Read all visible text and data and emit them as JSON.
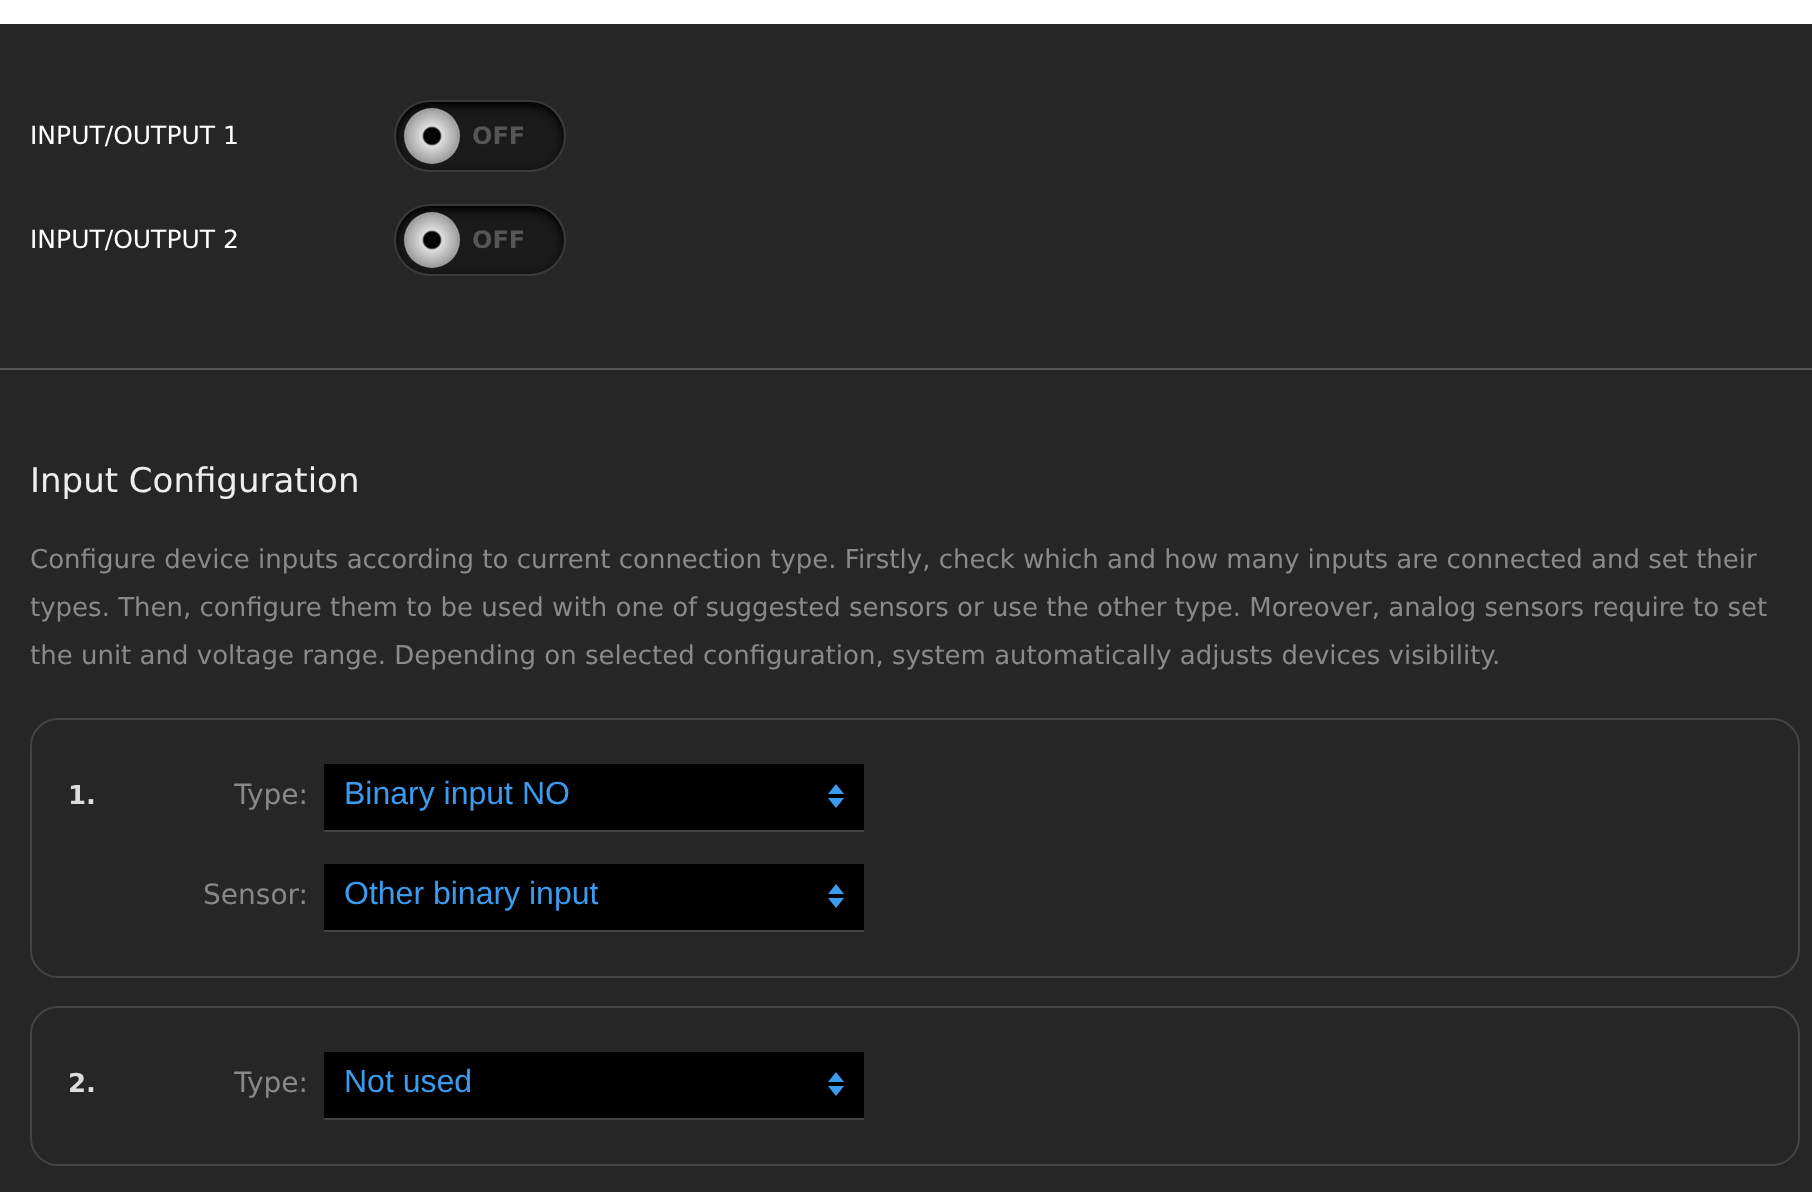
{
  "switches": [
    {
      "label": "INPUT/OUTPUT 1",
      "on": false,
      "state_text": "OFF"
    },
    {
      "label": "INPUT/OUTPUT 2",
      "on": false,
      "state_text": "OFF"
    }
  ],
  "section": {
    "title": "Input Configuration",
    "description": "Configure device inputs according to current connection type. Firstly, check which and how many inputs are connected and set their types. Then, configure them to be used with one of suggested sensors or use the other type. Moreover, analog sensors require to set the unit and voltage range. Depending on selected configuration, system automatically adjusts devices visibility."
  },
  "inputs": [
    {
      "number": "1.",
      "fields": [
        {
          "label": "Type:",
          "value": "Binary input NO"
        },
        {
          "label": "Sensor:",
          "value": "Other binary input"
        }
      ]
    },
    {
      "number": "2.",
      "fields": [
        {
          "label": "Type:",
          "value": "Not used"
        }
      ]
    }
  ]
}
